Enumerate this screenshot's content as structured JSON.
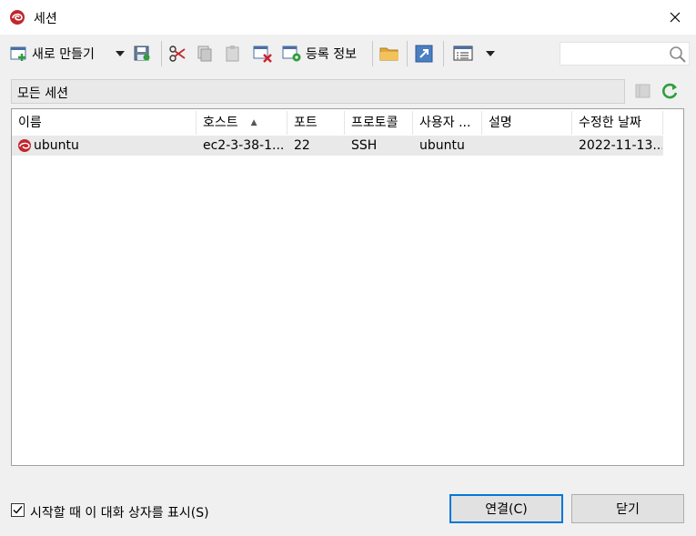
{
  "window": {
    "title": "세션"
  },
  "toolbar": {
    "new_label": "새로 만들기",
    "properties_label": "등록 정보"
  },
  "search": {
    "placeholder": ""
  },
  "filter": {
    "label": "모든 세션"
  },
  "table": {
    "columns": [
      "이름",
      "호스트",
      "포트",
      "프로토콜",
      "사용자 ...",
      "설명",
      "수정한 날짜"
    ],
    "rows": [
      {
        "name": "ubuntu",
        "host": "ec2-3-38-1...",
        "port": "22",
        "protocol": "SSH",
        "user": "ubuntu",
        "description": "",
        "modified": "2022-11-13..."
      }
    ]
  },
  "footer": {
    "show_on_startup_label": "시작할 때 이 대화 상자를 표시(S)",
    "show_on_startup_checked": true,
    "connect_label": "연결(C)",
    "close_label": "닫기"
  },
  "colors": {
    "accent": "#0078d7",
    "brand": "#c1272d"
  }
}
